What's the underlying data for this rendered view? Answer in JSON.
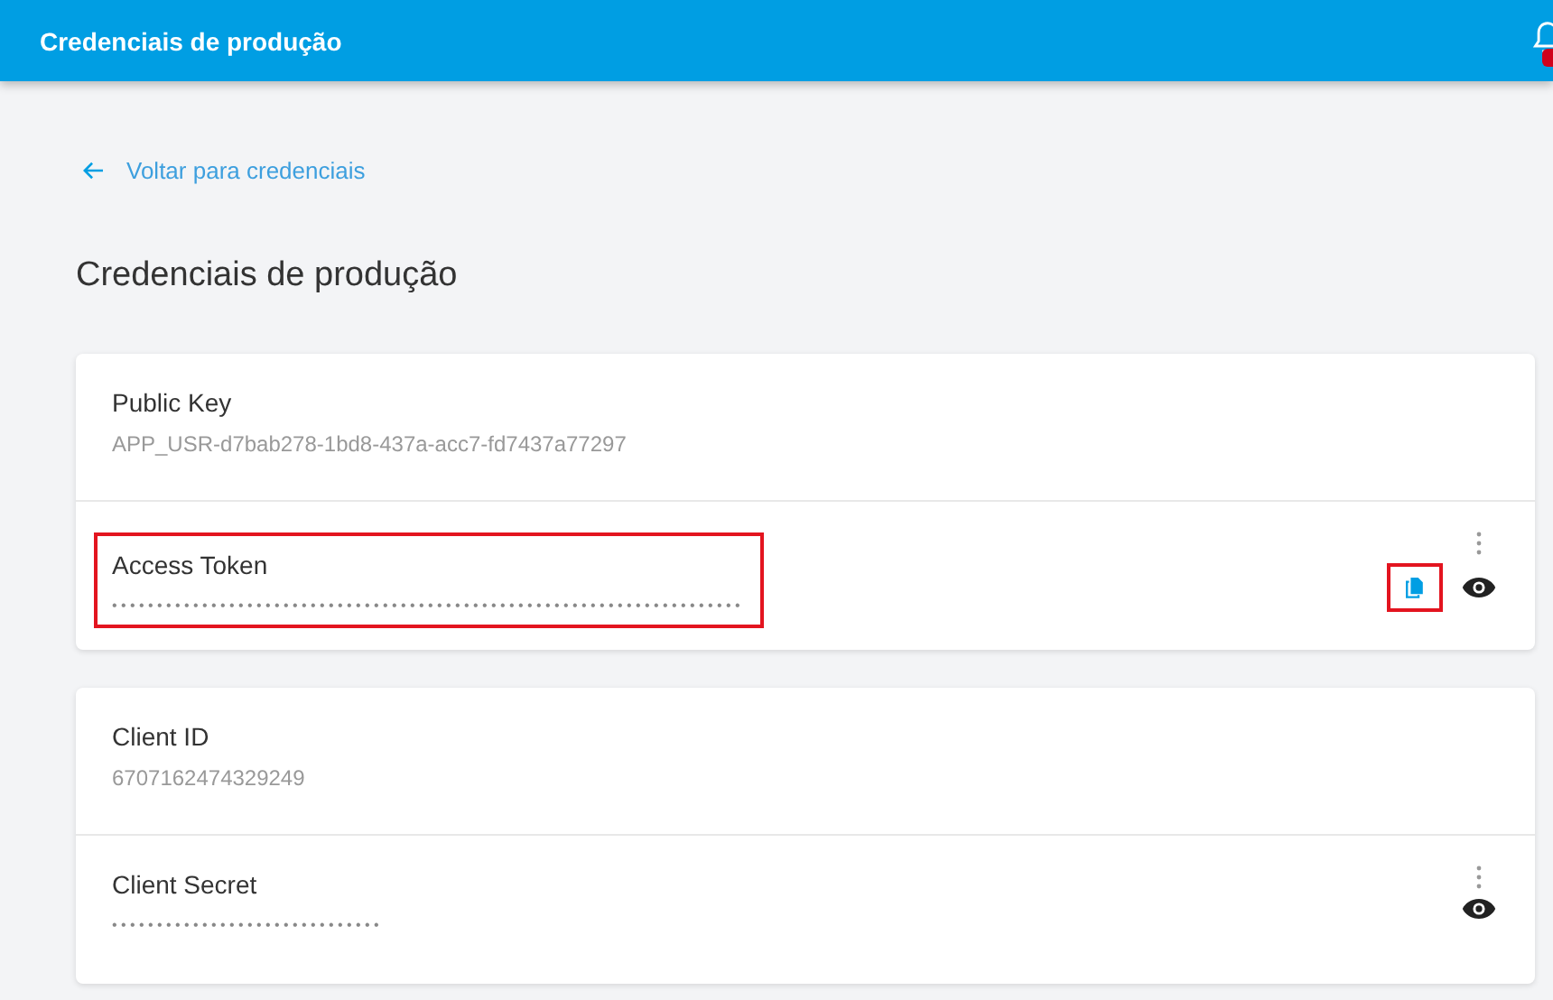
{
  "header": {
    "title": "Credenciais de produção",
    "notification_badge": true
  },
  "back_link": {
    "label": "Voltar para credenciais"
  },
  "heading": "Credenciais de produção",
  "cards": [
    {
      "rows": [
        {
          "kind": "plain",
          "label": "Public Key",
          "value": "APP_USR-d7bab278-1bd8-437a-acc7-fd7437a77297",
          "highlighted": false
        },
        {
          "kind": "secret",
          "label": "Access Token",
          "value": "••••••••••••••••••••••••••••••••••••••••••••••••••••••••••••••••••••••",
          "highlighted": true,
          "copy_button": {
            "highlighted": true
          }
        }
      ]
    },
    {
      "rows": [
        {
          "kind": "plain",
          "label": "Client ID",
          "value": "6707162474329249",
          "highlighted": false
        },
        {
          "kind": "secret",
          "label": "Client Secret",
          "value": "••••••••••••••••••••••••••••••",
          "highlighted": false
        }
      ]
    }
  ]
}
